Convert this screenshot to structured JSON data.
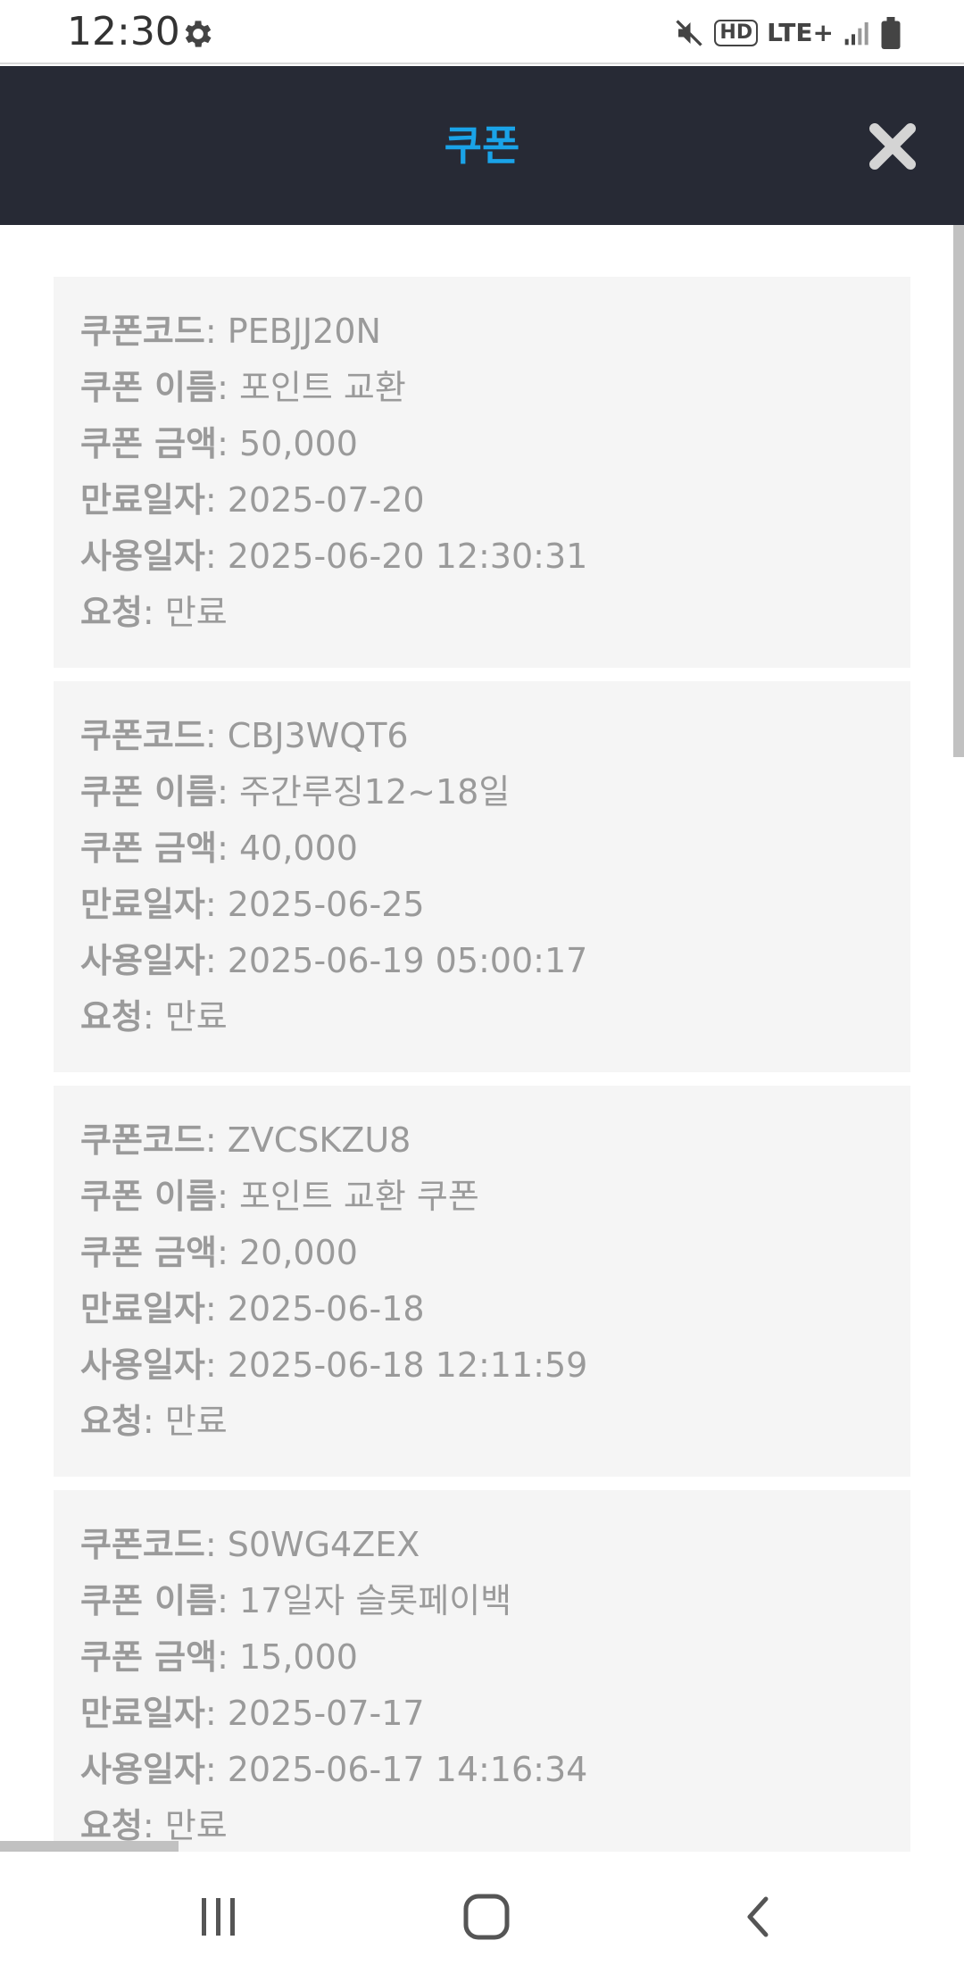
{
  "status_bar": {
    "time": "12:30",
    "hd_label": "HD",
    "network_label": "LTE+"
  },
  "header": {
    "title": "쿠폰"
  },
  "labels": {
    "code": "쿠폰코드",
    "name": "쿠폰 이름",
    "amount": "쿠폰 금액",
    "expiry": "만료일자",
    "used": "사용일자",
    "request": "요청",
    "separator": ": "
  },
  "coupons": [
    {
      "code": "PEBJJ20N",
      "name": "포인트 교환",
      "amount": "50,000",
      "expiry": "2025-07-20",
      "used": "2025-06-20 12:30:31",
      "request": "만료"
    },
    {
      "code": "CBJ3WQT6",
      "name": "주간루징12~18일",
      "amount": "40,000",
      "expiry": "2025-06-25",
      "used": "2025-06-19 05:00:17",
      "request": "만료"
    },
    {
      "code": "ZVCSKZU8",
      "name": "포인트 교환 쿠폰",
      "amount": "20,000",
      "expiry": "2025-06-18",
      "used": "2025-06-18 12:11:59",
      "request": "만료"
    },
    {
      "code": "S0WG4ZEX",
      "name": "17일자 슬롯페이백",
      "amount": "15,000",
      "expiry": "2025-07-17",
      "used": "2025-06-17 14:16:34",
      "request": "만료"
    }
  ],
  "colors": {
    "header_bg": "#272a35",
    "title_accent": "#1aa3e8",
    "card_bg": "#f5f5f5",
    "text_gray": "#9a9a9a"
  }
}
